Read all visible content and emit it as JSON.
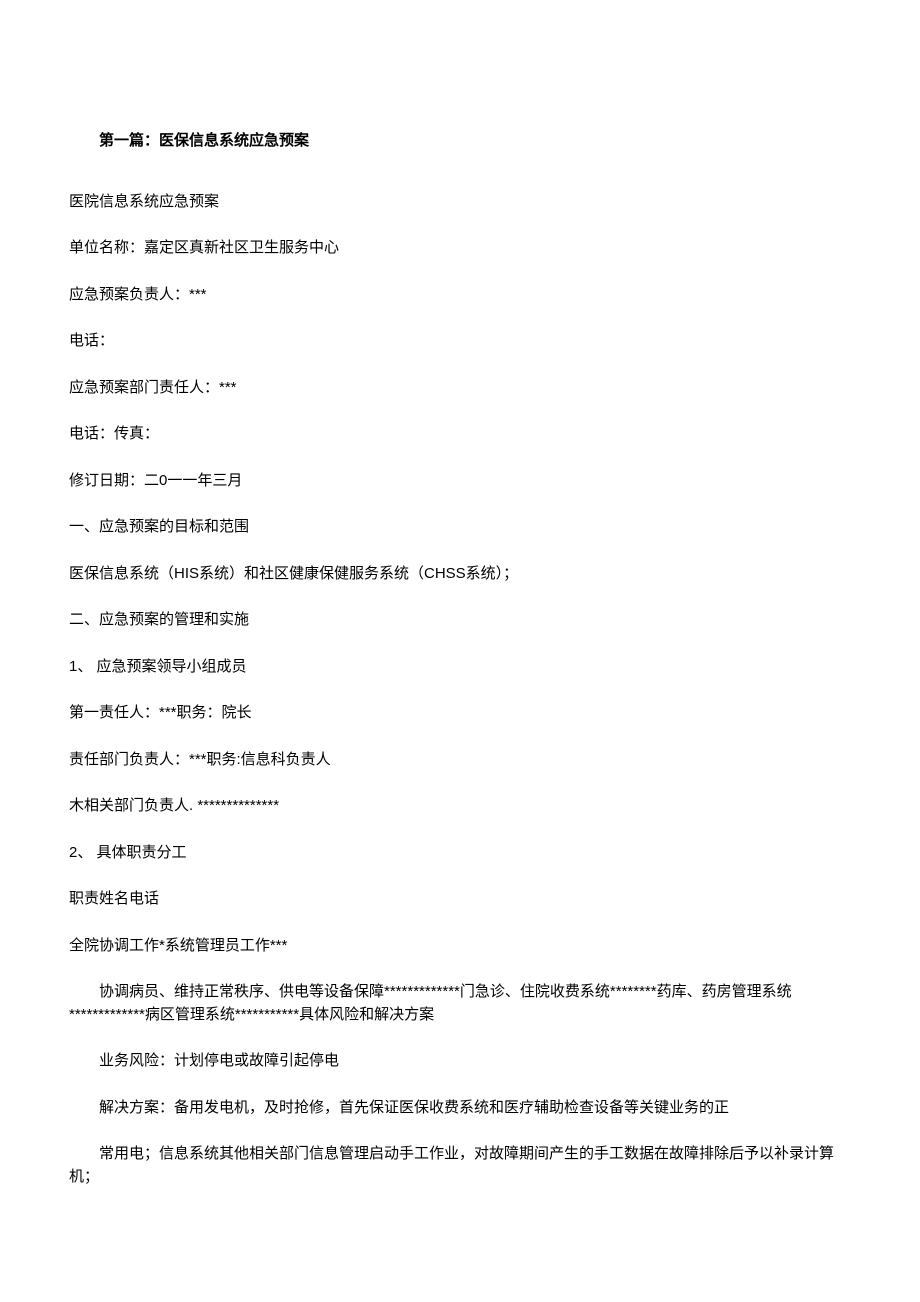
{
  "heading": "第一篇：医保信息系统应急预案",
  "p1": "医院信息系统应急预案",
  "p2": "单位名称：嘉定区真新社区卫生服务中心",
  "p3": "应急预案负责人：***",
  "p4": "电话：",
  "p5": "应急预案部门责任人：***",
  "p6": "电话：传真：",
  "p7": "修订日期：二0一一年三月",
  "p8": "一、应急预案的目标和范围",
  "p9": "医保信息系统（HIS系统）和社区健康保健服务系统（CHSS系统）；",
  "p10": "二、应急预案的管理和实施",
  "p11": "1、  应急预案领导小组成员",
  "p12": "第一责任人：***职务：院长",
  "p13": "责任部门负责人：***职务:信息科负责人",
  "p14": "木相关部门负责人. **************",
  "p15": "2、  具体职责分工",
  "p16": "职责姓名电话",
  "p17": "全院协调工作*系统管理员工作***",
  "p18": "协调病员、维持正常秩序、供电等设备保障*************门急诊、住院收费系统********药库、药房管理系统*************病区管理系统***********具体风险和解决方案",
  "p19": "业务风险：计划停电或故障引起停电",
  "p20": "解决方案：备用发电机，及时抢修，首先保证医保收费系统和医疗辅助检查设备等关键业务的正",
  "p21": "常用电；信息系统其他相关部门信息管理启动手工作业，对故障期间产生的手工数据在故障排除后予以补录计算机；"
}
